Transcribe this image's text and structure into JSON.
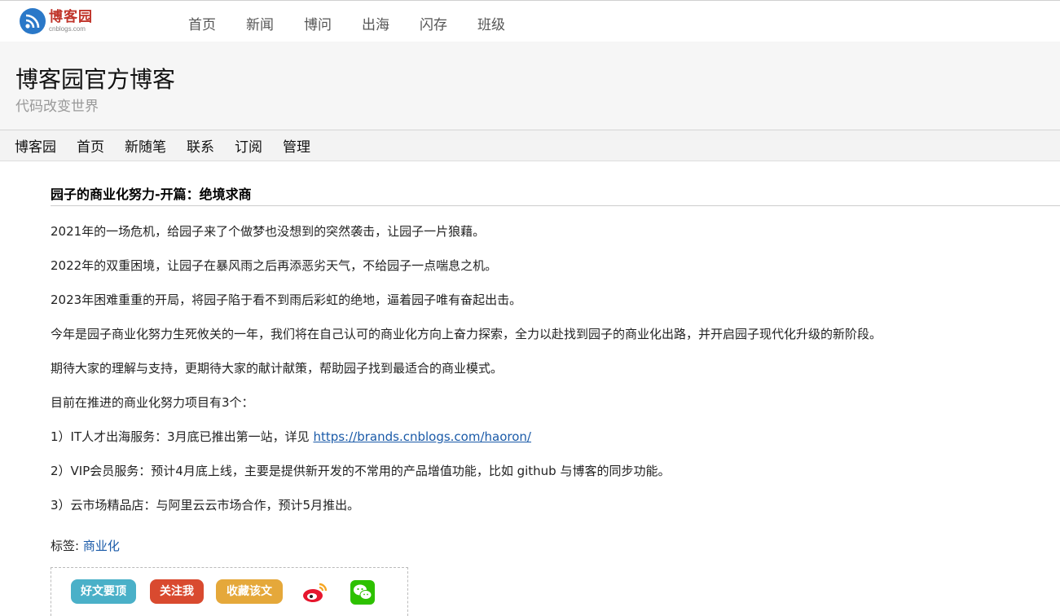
{
  "site": {
    "logo_cn": "博客园",
    "logo_en": "cnblogs.com",
    "nav": [
      "首页",
      "新闻",
      "博问",
      "出海",
      "闪存",
      "班级"
    ]
  },
  "blog": {
    "title": "博客园官方博客",
    "subtitle": "代码改变世界",
    "nav": [
      "博客园",
      "首页",
      "新随笔",
      "联系",
      "订阅",
      "管理"
    ]
  },
  "post": {
    "title": "园子的商业化努力-开篇：绝境求商",
    "paragraphs": [
      "2021年的一场危机，给园子来了个做梦也没想到的突然袭击，让园子一片狼藉。",
      "2022年的双重困境，让园子在暴风雨之后再添恶劣天气，不给园子一点喘息之机。",
      "2023年困难重重的开局，将园子陷于看不到雨后彩虹的绝地，逼着园子唯有奋起出击。",
      "今年是园子商业化努力生死攸关的一年，我们将在自己认可的商业化方向上奋力探索，全力以赴找到园子的商业化出路，并开启园子现代化升级的新阶段。",
      "期待大家的理解与支持，更期待大家的献计献策，帮助园子找到最适合的商业模式。",
      "目前在推进的商业化努力项目有3个："
    ],
    "item1_text": "1）IT人才出海服务：3月底已推出第一站，详见 ",
    "item1_link": "https://brands.cnblogs.com/haoron/",
    "item2_text": "2）VIP会员服务：预计4月底上线，主要是提供新开发的不常用的产品增值功能，比如 github 与博客的同步功能。",
    "item3_text": "3）云市场精品店：与阿里云云市场合作，预计5月推出。",
    "tags_label": "标签: ",
    "tag": "商业化"
  },
  "share": {
    "good_label": "好文要顶",
    "follow_label": "关注我",
    "fav_label": "收藏该文",
    "icons": [
      "weibo-icon",
      "wechat-icon"
    ]
  }
}
